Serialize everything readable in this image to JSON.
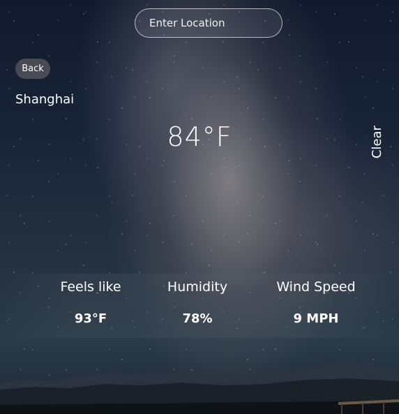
{
  "search": {
    "placeholder": "Enter Location",
    "value": ""
  },
  "nav": {
    "back_label": "Back"
  },
  "weather": {
    "city": "Shanghai",
    "temperature": "84°F",
    "condition": "Clear"
  },
  "stats": [
    {
      "label": "Feels like",
      "value": "93°F"
    },
    {
      "label": "Humidity",
      "value": "78%"
    },
    {
      "label": "Wind Speed",
      "value": "9 MPH"
    }
  ]
}
